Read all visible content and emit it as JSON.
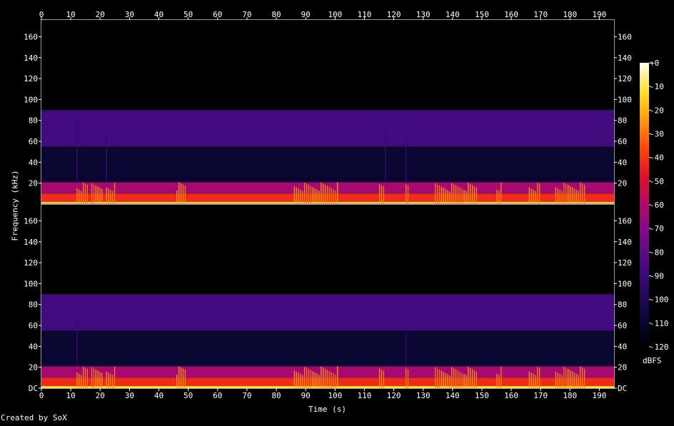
{
  "chart_data": {
    "type": "heatmap",
    "xlabel": "Time (s)",
    "ylabel": "Frequency (kHz)",
    "x_ticks": [
      0,
      10,
      20,
      30,
      40,
      50,
      60,
      70,
      80,
      90,
      100,
      110,
      120,
      130,
      140,
      150,
      160,
      170,
      180,
      190
    ],
    "x_range": [
      0,
      195
    ],
    "y_range": [
      0,
      176
    ],
    "y_ticks_top": [
      "20",
      "40",
      "60",
      "80",
      "100",
      "120",
      "140",
      "160"
    ],
    "y_ticks_bottom": [
      "DC",
      "20",
      "40",
      "60",
      "80",
      "100",
      "120",
      "140",
      "160"
    ],
    "colorbar": {
      "label": "dBFS",
      "ticks": [
        "+0",
        "-10",
        "-20",
        "-30",
        "-40",
        "-50",
        "-60",
        "-70",
        "-80",
        "-90",
        "-100",
        "-110",
        "-120"
      ],
      "range": [
        -120,
        0
      ]
    },
    "channels": [
      {
        "bands": [
          {
            "from_khz": 0,
            "to_khz": 2,
            "dbfs": -20
          },
          {
            "from_khz": 2,
            "to_khz": 10,
            "dbfs": -55
          },
          {
            "from_khz": 10,
            "to_khz": 21,
            "dbfs": -75
          },
          {
            "from_khz": 21,
            "to_khz": 55,
            "dbfs": -112
          },
          {
            "from_khz": 55,
            "to_khz": 90,
            "dbfs": -95
          },
          {
            "from_khz": 90,
            "to_khz": 176,
            "dbfs": -125
          }
        ],
        "bursts": [
          [
            12,
            16
          ],
          [
            17,
            21
          ],
          [
            22,
            25
          ],
          [
            46,
            49
          ],
          [
            86,
            101
          ],
          [
            115,
            117
          ],
          [
            124,
            125
          ],
          [
            134,
            148
          ],
          [
            155,
            157
          ],
          [
            166,
            170
          ],
          [
            175,
            185
          ]
        ],
        "spikes": [
          [
            12,
            78
          ],
          [
            22,
            65
          ],
          [
            117,
            70
          ],
          [
            124,
            70
          ]
        ]
      },
      {
        "bands": [
          {
            "from_khz": 0,
            "to_khz": 2,
            "dbfs": -20
          },
          {
            "from_khz": 2,
            "to_khz": 10,
            "dbfs": -55
          },
          {
            "from_khz": 10,
            "to_khz": 21,
            "dbfs": -75
          },
          {
            "from_khz": 21,
            "to_khz": 55,
            "dbfs": -112
          },
          {
            "from_khz": 55,
            "to_khz": 90,
            "dbfs": -95
          },
          {
            "from_khz": 90,
            "to_khz": 176,
            "dbfs": -125
          }
        ],
        "bursts": [
          [
            12,
            16
          ],
          [
            17,
            21
          ],
          [
            22,
            25
          ],
          [
            46,
            49
          ],
          [
            86,
            101
          ],
          [
            115,
            117
          ],
          [
            124,
            125
          ],
          [
            134,
            148
          ],
          [
            155,
            157
          ],
          [
            166,
            170
          ],
          [
            175,
            185
          ]
        ],
        "spikes": [
          [
            12,
            65
          ],
          [
            124,
            52
          ]
        ]
      }
    ]
  },
  "footer": {
    "credit": "Created by SoX"
  }
}
